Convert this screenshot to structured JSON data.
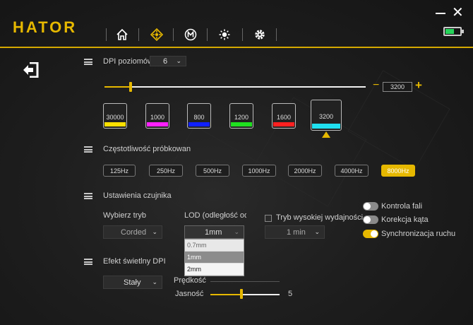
{
  "app": {
    "logo": "HATOR"
  },
  "nav": {
    "icons": [
      "home-icon",
      "dpi-target-icon",
      "macro-icon",
      "lighting-icon",
      "settings-icon"
    ],
    "active": "dpi-target-icon"
  },
  "window": {
    "minimize": "—",
    "close": "✕"
  },
  "battery": {
    "level": 0.6,
    "color": "#26d45a"
  },
  "dpi": {
    "levels_label": "DPI poziomów",
    "levels_value": "6",
    "current_value": "3200",
    "minus": "−",
    "plus": "+",
    "slider_fraction": 0.1,
    "presets": [
      {
        "value": "30000",
        "color": "#ffe000"
      },
      {
        "value": "1000",
        "color": "#ff20ff"
      },
      {
        "value": "800",
        "color": "#1020ff"
      },
      {
        "value": "1200",
        "color": "#20e020"
      },
      {
        "value": "1600",
        "color": "#ff2020"
      },
      {
        "value": "3200",
        "color": "#20e0f0",
        "active": true
      }
    ]
  },
  "polling": {
    "label": "Częstotliwość próbkowan",
    "rates": [
      "125Hz",
      "250Hz",
      "500Hz",
      "1000Hz",
      "2000Hz",
      "4000Hz",
      "8000Hz"
    ],
    "active": "8000Hz"
  },
  "sensor": {
    "label": "Ustawienia czujnika",
    "mode_label": "Wybierz tryb",
    "mode_value": "Corded",
    "lod_label": "LOD (odległość odry",
    "lod_value": "1mm",
    "lod_options": [
      "0.7mm",
      "1mm",
      "2mm"
    ],
    "hp_label": "Tryb wysokiej wydajności",
    "hp_value": "1 min",
    "toggles": [
      {
        "label": "Kontrola fali",
        "on": false
      },
      {
        "label": "Korekcja kąta",
        "on": false
      },
      {
        "label": "Synchronizacja ruchu",
        "on": true
      }
    ]
  },
  "lighting": {
    "label": "Efekt świetlny DPI",
    "effect_value": "Stały",
    "speed_label": "Prędkość",
    "brightness_label": "Jasność",
    "brightness_value": "5",
    "brightness_fraction": 0.45
  },
  "colors": {
    "accent": "#e6b800"
  }
}
